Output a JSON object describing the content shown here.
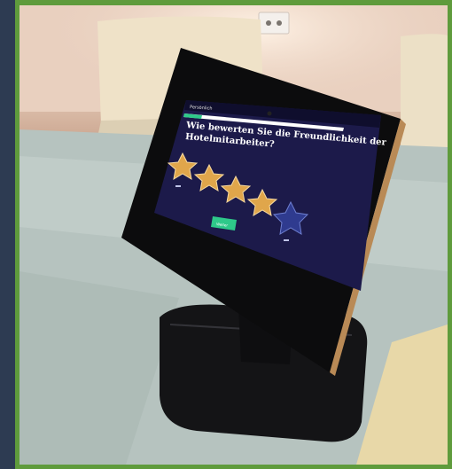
{
  "kiosk": {
    "header_label": "Persönlich",
    "question": "Wie bewerten Sie die Freundlichkeit der Hotelmitarbeiter?",
    "rating": {
      "max": 5,
      "filled": 4
    },
    "button_label": "Weiter",
    "progress": 0.18
  },
  "colors": {
    "frame": "#5f9b3c",
    "screen_bg": "#1c1a4a",
    "star_gold": "#e0a64b",
    "star_empty": "#2f3b8f",
    "button": "#2ec98a"
  }
}
